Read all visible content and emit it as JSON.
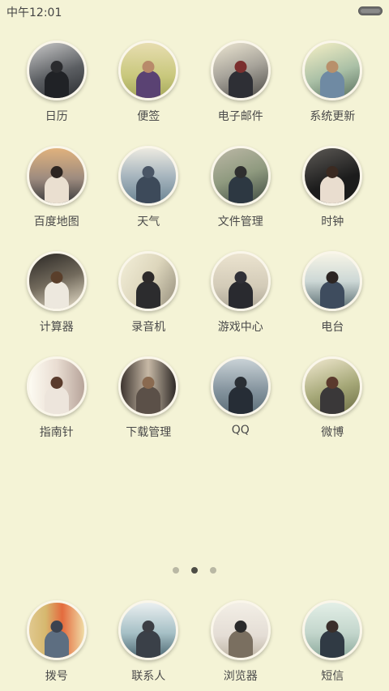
{
  "status": {
    "time": "中午12:01"
  },
  "apps": [
    {
      "label": "日历",
      "icon": "photo-person-icon",
      "bg": "linear-gradient(160deg,#c9c9c9,#5b5e62 55%,#2b2d31)",
      "fig": "#202226",
      "head": "#2a2b2e"
    },
    {
      "label": "便签",
      "icon": "photo-person-icon",
      "bg": "linear-gradient(180deg,#e7ddb0,#c9c87d 60%,#a6a85c)",
      "fig": "#5a4273",
      "head": "#b88a6a"
    },
    {
      "label": "电子邮件",
      "icon": "photo-person-icon",
      "bg": "linear-gradient(160deg,#ece6d2,#a7a39a 50%,#4d4b47)",
      "fig": "#2e2f35",
      "head": "#7b2f2e"
    },
    {
      "label": "系统更新",
      "icon": "photo-person-icon",
      "bg": "linear-gradient(160deg,#f6f0c6,#aac0a6 55%,#59705f)",
      "fig": "#6f8aa3",
      "head": "#b8906b"
    },
    {
      "label": "百度地图",
      "icon": "photo-person-icon",
      "bg": "linear-gradient(180deg,#e0b27d,#9d8b7f 55%,#3b3c3d)",
      "fig": "#eadfd0",
      "head": "#2d2521"
    },
    {
      "label": "天气",
      "icon": "photo-person-icon",
      "bg": "linear-gradient(180deg,#eceae1,#a8b6bf 50%,#6b8493)",
      "fig": "#3d4a5a",
      "head": "#4a5666"
    },
    {
      "label": "文件管理",
      "icon": "photo-person-icon",
      "bg": "linear-gradient(160deg,#bcb8a6,#8f9a7f 50%,#3e4a41)",
      "fig": "#2d3842",
      "head": "#2f2f2f"
    },
    {
      "label": "时钟",
      "icon": "photo-person-icon",
      "bg": "linear-gradient(160deg,#5d5a56,#1c1c1c 60%)",
      "fig": "#e9ddcf",
      "head": "#3b2a21"
    },
    {
      "label": "计算器",
      "icon": "photo-person-icon",
      "bg": "linear-gradient(160deg,#2a2724,#726a5c 50%,#e8e0cb)",
      "fig": "#ede8de",
      "head": "#5a3f2b"
    },
    {
      "label": "录音机",
      "icon": "photo-person-icon",
      "bg": "linear-gradient(120deg,#f3efd9,#ddd6bc 50%,#958e7c)",
      "fig": "#2c2c2e",
      "head": "#2d2a2a"
    },
    {
      "label": "游戏中心",
      "icon": "photo-person-icon",
      "bg": "linear-gradient(180deg,#ebe3cf,#d3cbb8 60%,#aea898)",
      "fig": "#292a2f",
      "head": "#303037"
    },
    {
      "label": "电台",
      "icon": "photo-person-icon",
      "bg": "linear-gradient(180deg,#f6f4e6,#cdd8d6 50%,#5e7175)",
      "fig": "#3e4c5e",
      "head": "#2c2523"
    },
    {
      "label": "指南针",
      "icon": "photo-person-icon",
      "bg": "linear-gradient(90deg,#fdfbf2,#e9ddd2 50%,#b7a49a)",
      "fig": "#ede5dc",
      "head": "#5a3b2c"
    },
    {
      "label": "下载管理",
      "icon": "photo-person-icon",
      "bg": "linear-gradient(90deg,#3e3530,#c7b9a6 50%,#2f2a27)",
      "fig": "#5b5048",
      "head": "#8a6a50"
    },
    {
      "label": "QQ",
      "icon": "photo-person-icon",
      "bg": "linear-gradient(180deg,#c9d2d6,#8796a0 55%,#5d6e79)",
      "fig": "#262d36",
      "head": "#2a2f35"
    },
    {
      "label": "微博",
      "icon": "photo-person-icon",
      "bg": "linear-gradient(160deg,#f1e9d0,#a6a878 55%,#6d6e45)",
      "fig": "#3a3839",
      "head": "#5b3a2d"
    }
  ],
  "pager": {
    "count": 3,
    "active": 1
  },
  "dock": [
    {
      "label": "拨号",
      "icon": "photo-person-icon",
      "bg": "linear-gradient(90deg,#e0c88e,#d6b86f 30%,#e46b3e 60%,#f0dca6)",
      "fig": "#5d6e81",
      "head": "#3b4350"
    },
    {
      "label": "联系人",
      "icon": "photo-person-icon",
      "bg": "linear-gradient(180deg,#eaeff0,#a6c0c6 55%,#4f6a74)",
      "fig": "#3a4048",
      "head": "#3c3e44"
    },
    {
      "label": "浏览器",
      "icon": "photo-person-icon",
      "bg": "linear-gradient(180deg,#f3efe6,#e4ddd5 60%,#bfb6a6)",
      "fig": "#7a6f60",
      "head": "#2a2a2a"
    },
    {
      "label": "短信",
      "icon": "photo-person-icon",
      "bg": "linear-gradient(180deg,#e3efe7,#c3d6cc 55%,#8daa9d)",
      "fig": "#303a44",
      "head": "#3a2f2b"
    }
  ],
  "colors": {
    "background": "#f4f3d6",
    "label": "#4a4a4a"
  }
}
